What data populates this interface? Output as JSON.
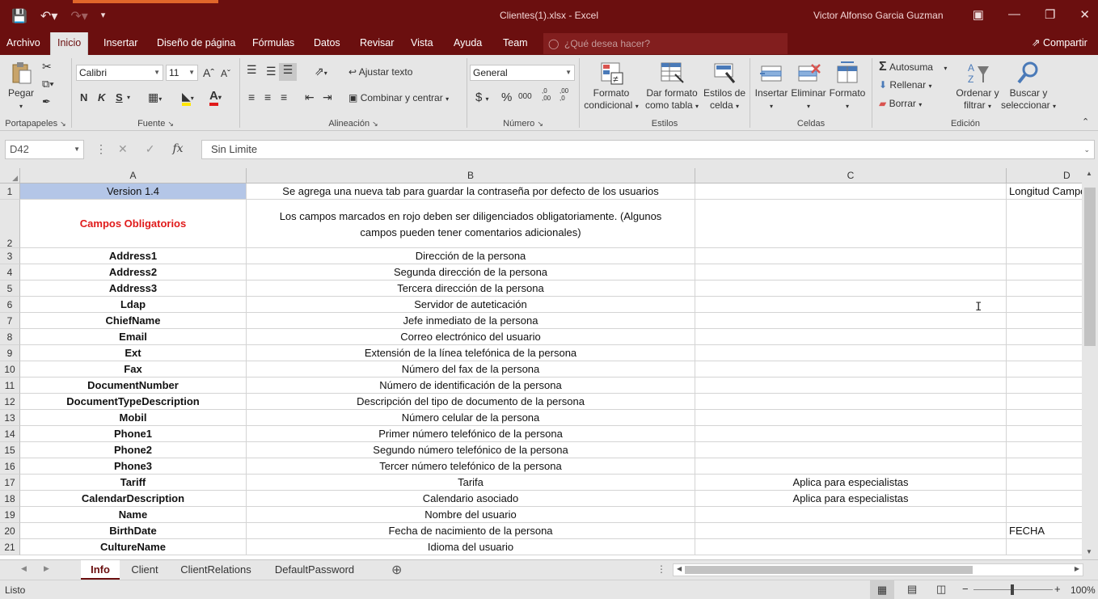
{
  "window": {
    "title": "Clientes(1).xlsx  -  Excel",
    "user": "Victor Alfonso Garcia Guzman"
  },
  "menu": {
    "tabs": [
      "Archivo",
      "Inicio",
      "Insertar",
      "Diseño de página",
      "Fórmulas",
      "Datos",
      "Revisar",
      "Vista",
      "Ayuda",
      "Team"
    ],
    "active_tab": "Inicio",
    "tell_me_placeholder": "¿Qué desea hacer?",
    "share": "Compartir"
  },
  "ribbon": {
    "clipboard": {
      "label": "Portapapeles",
      "paste": "Pegar"
    },
    "font": {
      "label": "Fuente",
      "name": "Calibri",
      "size": "11",
      "bold": "N",
      "italic": "K",
      "underline": "S"
    },
    "alignment": {
      "label": "Alineación",
      "wrap": "Ajustar texto",
      "merge": "Combinar y centrar"
    },
    "number": {
      "label": "Número",
      "format": "General",
      "currency": "$",
      "percent": "%",
      "thousands": "000",
      "inc_decimal": ",0 ,00",
      "dec_decimal": ",00 ,0"
    },
    "styles": {
      "label": "Estilos",
      "conditional": [
        "Formato",
        "condicional"
      ],
      "table": [
        "Dar formato",
        "como tabla"
      ],
      "cell_styles": [
        "Estilos de",
        "celda"
      ]
    },
    "cells": {
      "label": "Celdas",
      "insert": "Insertar",
      "delete": "Eliminar",
      "format": "Formato"
    },
    "editing": {
      "label": "Edición",
      "autosum": "Autosuma",
      "fill": "Rellenar",
      "clear": "Borrar",
      "sort": [
        "Ordenar y",
        "filtrar"
      ],
      "find": [
        "Buscar y",
        "seleccionar"
      ]
    }
  },
  "formula_bar": {
    "name_box": "D42",
    "content": "Sin Limite"
  },
  "sheet": {
    "columns": [
      "A",
      "B",
      "C",
      "D"
    ],
    "rows": [
      {
        "n": "1",
        "a": "Version 1.4",
        "b": "Se agrega una nueva tab para guardar la contraseña por defecto de los usuarios",
        "c": "",
        "d": "Longitud Campo"
      },
      {
        "n": "2",
        "a": "Campos Obligatorios",
        "b1": "Los campos marcados en rojo deben ser diligenciados obligatoriamente. (Algunos",
        "b2": "campos pueden tener comentarios adicionales)",
        "c": "",
        "d": ""
      },
      {
        "n": "3",
        "a": "Address1",
        "b": "Dirección de la persona",
        "c": "",
        "d": ""
      },
      {
        "n": "4",
        "a": "Address2",
        "b": "Segunda dirección de la persona",
        "c": "",
        "d": ""
      },
      {
        "n": "5",
        "a": "Address3",
        "b": "Tercera dirección de la persona",
        "c": "",
        "d": ""
      },
      {
        "n": "6",
        "a": "Ldap",
        "b": "Servidor de auteticación",
        "c": "",
        "d": ""
      },
      {
        "n": "7",
        "a": "ChiefName",
        "b": "Jefe inmediato de la persona",
        "c": "",
        "d": ""
      },
      {
        "n": "8",
        "a": "Email",
        "b": "Correo electrónico del usuario",
        "c": "",
        "d": ""
      },
      {
        "n": "9",
        "a": "Ext",
        "b": "Extensión de la línea telefónica de la persona",
        "c": "",
        "d": ""
      },
      {
        "n": "10",
        "a": "Fax",
        "b": "Número del fax de la persona",
        "c": "",
        "d": ""
      },
      {
        "n": "11",
        "a": "DocumentNumber",
        "b": "Número de identificación de la persona",
        "c": "",
        "d": ""
      },
      {
        "n": "12",
        "a": "DocumentTypeDescription",
        "b": "Descripción del tipo de documento de la persona",
        "c": "",
        "d": ""
      },
      {
        "n": "13",
        "a": "Mobil",
        "b": "Número celular de la persona",
        "c": "",
        "d": ""
      },
      {
        "n": "14",
        "a": "Phone1",
        "b": "Primer número telefónico de la persona",
        "c": "",
        "d": ""
      },
      {
        "n": "15",
        "a": "Phone2",
        "b": "Segundo número telefónico de la persona",
        "c": "",
        "d": ""
      },
      {
        "n": "16",
        "a": "Phone3",
        "b": "Tercer número telefónico de la persona",
        "c": "",
        "d": ""
      },
      {
        "n": "17",
        "a": "Tariff",
        "b": "Tarifa",
        "c": "Aplica  para especialistas",
        "d": ""
      },
      {
        "n": "18",
        "a": "CalendarDescription",
        "b": "Calendario asociado",
        "c": "Aplica  para especialistas",
        "d": ""
      },
      {
        "n": "19",
        "a": "Name",
        "b": "Nombre del usuario",
        "c": "",
        "d": ""
      },
      {
        "n": "20",
        "a": "BirthDate",
        "b": "Fecha de nacimiento de la persona",
        "c": "",
        "d": "FECHA"
      },
      {
        "n": "21",
        "a": "CultureName",
        "b": "Idioma del usuario",
        "c": "",
        "d": ""
      }
    ]
  },
  "sheets": {
    "tabs": [
      "Info",
      "Client",
      "ClientRelations",
      "DefaultPassword"
    ],
    "active": "Info"
  },
  "status": {
    "ready": "Listo",
    "zoom": "100%"
  },
  "colors": {
    "titlebar": "#6b0f0f",
    "required_red": "#e01b1b",
    "selected_cell": "#b4c6e7"
  }
}
